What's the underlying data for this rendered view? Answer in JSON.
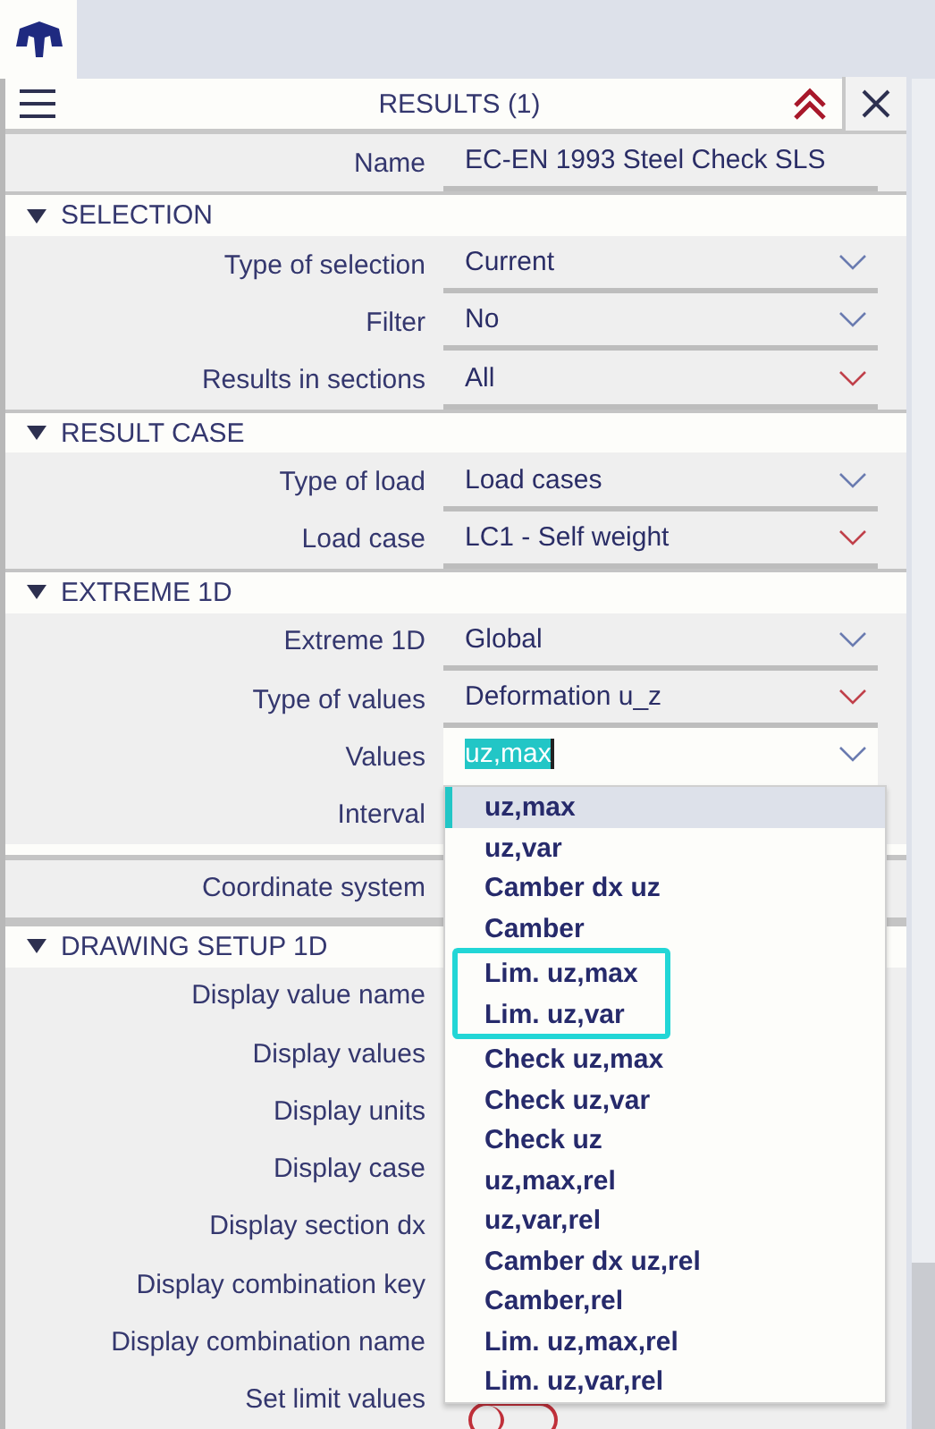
{
  "panel": {
    "title": "RESULTS (1)"
  },
  "name_row": {
    "label": "Name",
    "value": "EC-EN 1993 Steel Check SLS"
  },
  "sections": [
    {
      "title": "SELECTION",
      "expanded": true,
      "rows": [
        {
          "label": "Type of selection",
          "value": "Current",
          "kind": "select",
          "modified": false
        },
        {
          "label": "Filter",
          "value": "No",
          "kind": "select",
          "modified": false
        },
        {
          "label": "Results in sections",
          "value": "All",
          "kind": "select",
          "modified": true
        }
      ]
    },
    {
      "title": "RESULT CASE",
      "expanded": true,
      "rows": [
        {
          "label": "Type of load",
          "value": "Load cases",
          "kind": "select",
          "modified": false
        },
        {
          "label": "Load case",
          "value": "LC1 - Self weight",
          "kind": "select",
          "modified": true
        }
      ]
    },
    {
      "title": "EXTREME 1D",
      "expanded": true,
      "rows": [
        {
          "label": "Extreme 1D",
          "value": "Global",
          "kind": "select",
          "modified": false
        },
        {
          "label": "Type of values",
          "value": "Deformation u_z",
          "kind": "select",
          "modified": true
        },
        {
          "label": "Values",
          "value": "uz,max",
          "kind": "open-select",
          "modified": false
        },
        {
          "label": "Interval"
        }
      ],
      "extra_rows": [
        {
          "label": "Coordinate system"
        }
      ]
    },
    {
      "title": "DRAWING SETUP 1D",
      "expanded": true,
      "rows": [
        {
          "label": "Display value name"
        },
        {
          "label": "Display values"
        },
        {
          "label": "Display units"
        },
        {
          "label": "Display case"
        },
        {
          "label": "Display section dx"
        },
        {
          "label": "Display combination key"
        },
        {
          "label": "Display combination name"
        },
        {
          "label": "Set limit values",
          "kind": "toggle",
          "on": false
        }
      ]
    }
  ],
  "dropdown": {
    "items": [
      {
        "label": "uz,max",
        "selected": true,
        "boxed": false
      },
      {
        "label": "uz,var",
        "selected": false,
        "boxed": false
      },
      {
        "label": "Camber dx uz",
        "selected": false,
        "boxed": false
      },
      {
        "label": "Camber",
        "selected": false,
        "boxed": false
      },
      {
        "label": "Lim. uz,max",
        "selected": false,
        "boxed": true
      },
      {
        "label": "Lim. uz,var",
        "selected": false,
        "boxed": true
      },
      {
        "label": "Check uz,max",
        "selected": false,
        "boxed": false
      },
      {
        "label": "Check uz,var",
        "selected": false,
        "boxed": false
      },
      {
        "label": "Check uz",
        "selected": false,
        "boxed": false
      },
      {
        "label": "uz,max,rel",
        "selected": false,
        "boxed": false
      },
      {
        "label": "uz,var,rel",
        "selected": false,
        "boxed": false
      },
      {
        "label": "Camber dx uz,rel",
        "selected": false,
        "boxed": false
      },
      {
        "label": "Camber,rel",
        "selected": false,
        "boxed": false
      },
      {
        "label": "Lim. uz,max,rel",
        "selected": false,
        "boxed": false
      },
      {
        "label": "Lim. uz,var,rel",
        "selected": false,
        "boxed": false
      }
    ]
  }
}
